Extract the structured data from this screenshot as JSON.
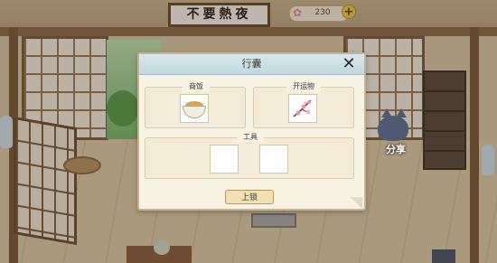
{
  "scene": {
    "sign_text": "不要熱夜",
    "share_label": "分享"
  },
  "currency": {
    "icon": "sakura-icon",
    "value": "230",
    "plus_label": "+"
  },
  "modal": {
    "title": "行囊",
    "close_label": "✕",
    "slots": {
      "food_label": "商饭",
      "gift_label": "开运物",
      "tools_label": "工具"
    },
    "lock_button_label": "上锁"
  },
  "colors": {
    "header_blue": "#c3d7de",
    "panel_bg": "#f8f2e2",
    "button_bg": "#f2dfb2",
    "plus_gold": "#f2c94c"
  }
}
